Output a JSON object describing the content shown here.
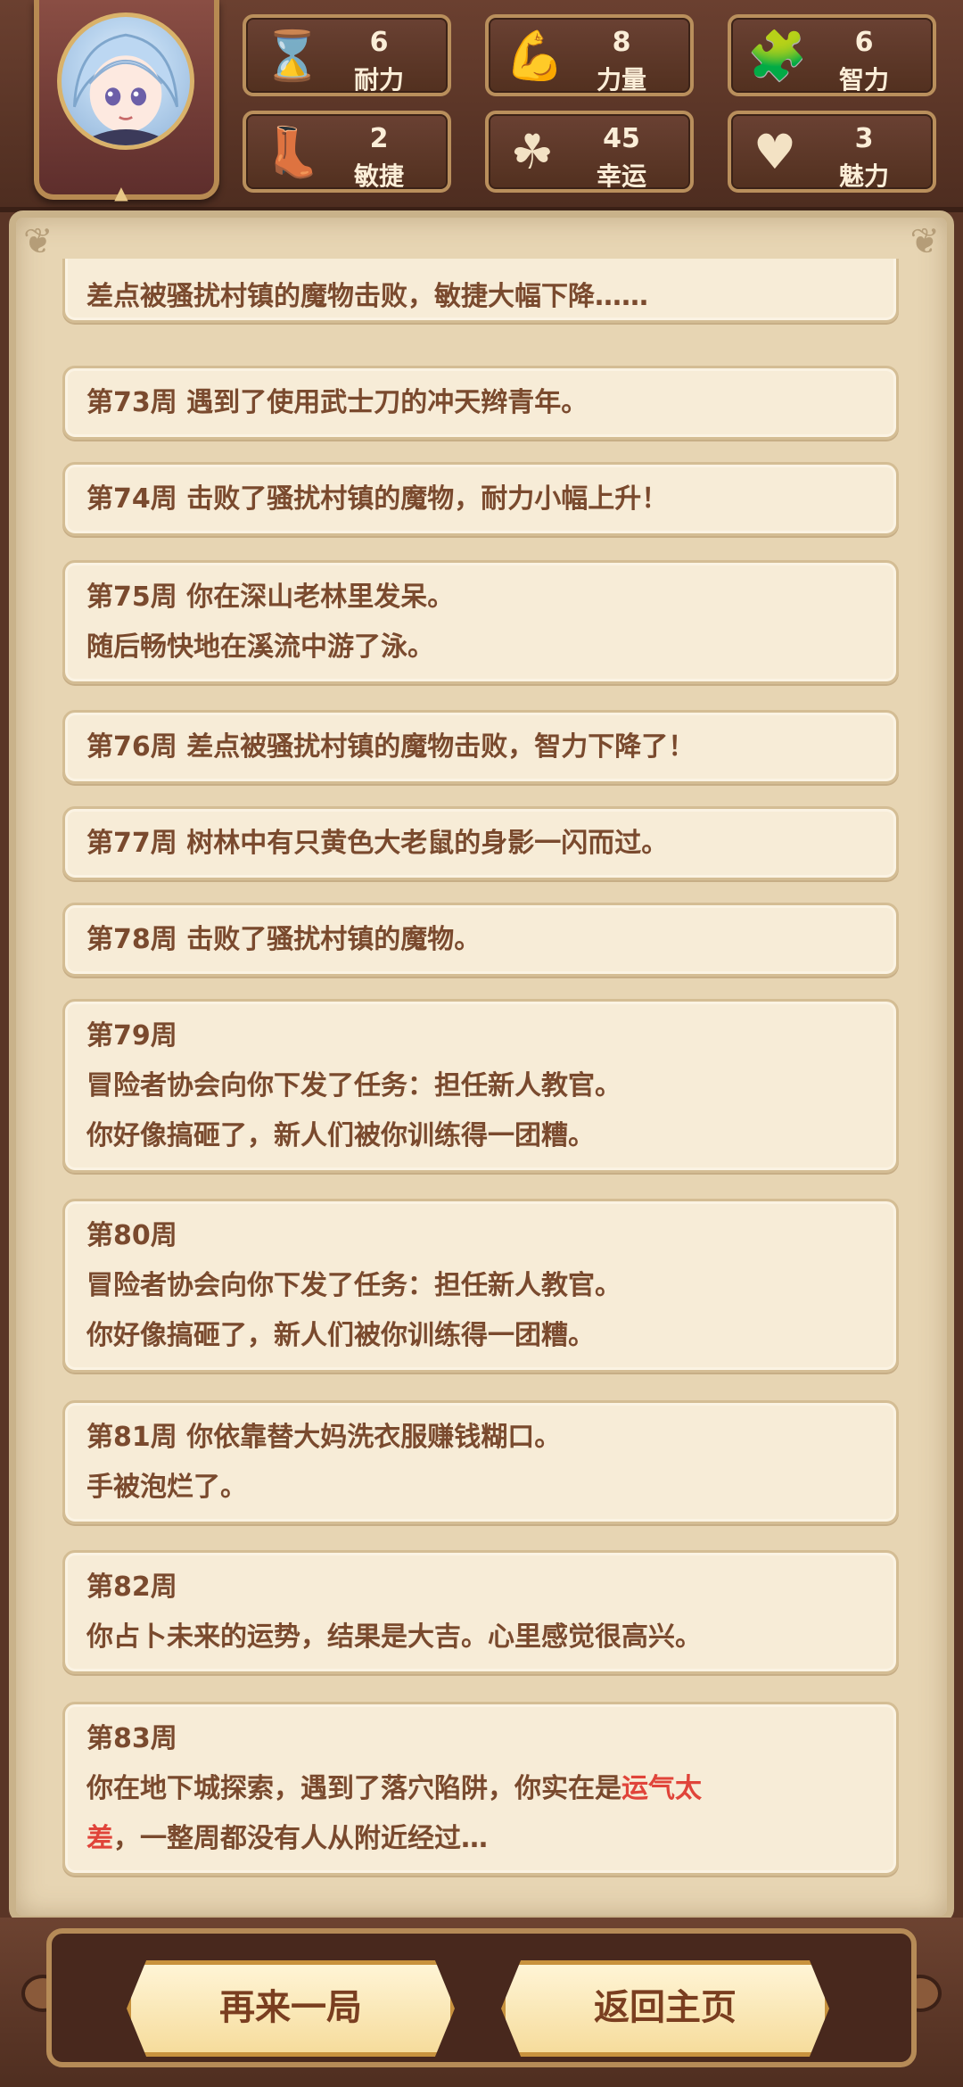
{
  "stats": [
    {
      "icon": "hourglass-icon",
      "value": "6",
      "label": "耐力"
    },
    {
      "icon": "muscle-arm-icon",
      "value": "8",
      "label": "力量"
    },
    {
      "icon": "puzzle-icon",
      "value": "6",
      "label": "智力"
    },
    {
      "icon": "feather-boot-icon",
      "value": "2",
      "label": "敏捷"
    },
    {
      "icon": "clover-icon",
      "value": "45",
      "label": "幸运"
    },
    {
      "icon": "heart-plus-icon",
      "value": "3",
      "label": "魅力"
    }
  ],
  "log": {
    "entries": [
      {
        "lines": [
          "差点被骚扰村镇的魔物击败，敏捷大幅下降……"
        ]
      },
      {
        "lines": [
          "第73周 遇到了使用武士刀的冲天辫青年。"
        ]
      },
      {
        "lines": [
          "第74周 击败了骚扰村镇的魔物，耐力小幅上升！"
        ]
      },
      {
        "lines": [
          "第75周 你在深山老林里发呆。",
          "随后畅快地在溪流中游了泳。"
        ]
      },
      {
        "lines": [
          "第76周 差点被骚扰村镇的魔物击败，智力下降了！"
        ]
      },
      {
        "lines": [
          "第77周 树林中有只黄色大老鼠的身影一闪而过。"
        ]
      },
      {
        "lines": [
          "第78周 击败了骚扰村镇的魔物。"
        ]
      },
      {
        "lines": [
          "第79周",
          "冒险者协会向你下发了任务：担任新人教官。",
          "你好像搞砸了，新人们被你训练得一团糟。"
        ]
      },
      {
        "lines": [
          "第80周",
          "冒险者协会向你下发了任务：担任新人教官。",
          "你好像搞砸了，新人们被你训练得一团糟。"
        ]
      },
      {
        "lines": [
          "第81周 你依靠替大妈洗衣服赚钱糊口。",
          "手被泡烂了。"
        ]
      },
      {
        "lines": [
          "第82周",
          "你占卜未来的运势，结果是大吉。心里感觉很高兴。"
        ]
      },
      {
        "lines": [
          "第83周"
        ],
        "line2_prefix": "你在地下城探索，遇到了落穴陷阱，你实在是",
        "line2_highlight": "运气太",
        "line3_highlight": "差",
        "line3_suffix": "，一整周都没有人从附近经过…"
      }
    ]
  },
  "footer": {
    "replay_label": "再来一局",
    "home_label": "返回主页"
  },
  "colors": {
    "accent_text": "#7a4a2e",
    "highlight": "#e0443a"
  }
}
